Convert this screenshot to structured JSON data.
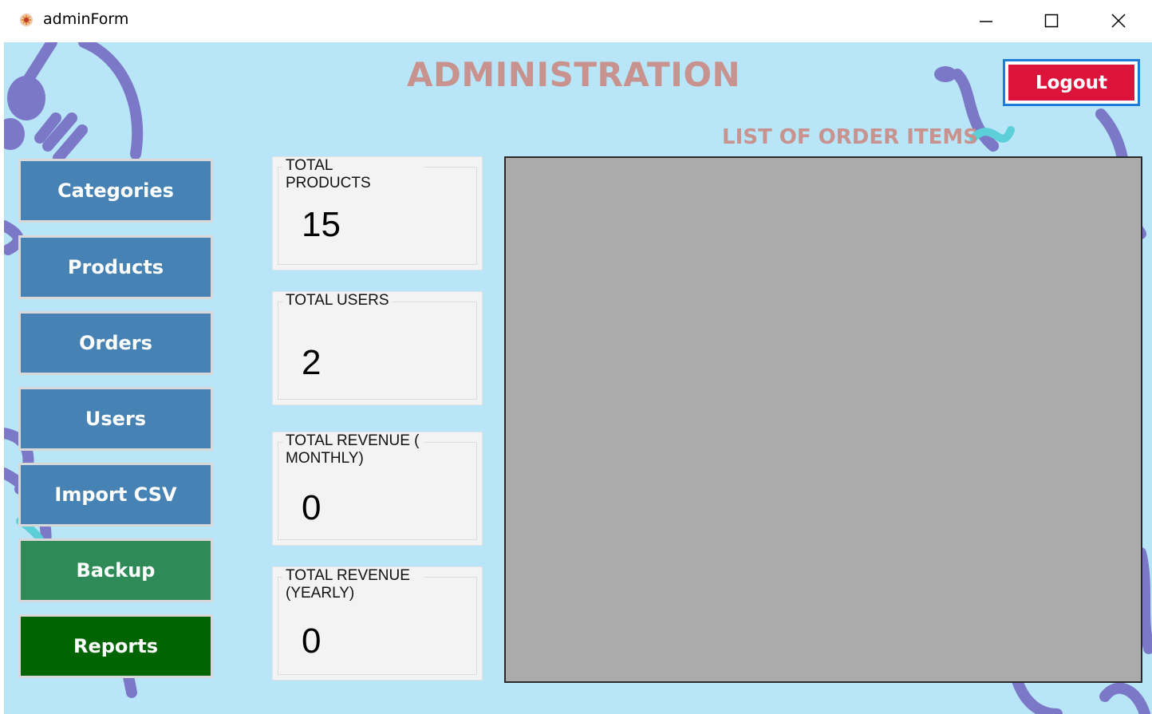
{
  "window": {
    "title": "adminForm",
    "icons": {
      "app": "app-icon",
      "minimize": "minimize-icon",
      "maximize": "maximize-icon",
      "close": "close-icon"
    }
  },
  "header": {
    "title": "ADMINISTRATION",
    "logout_label": "Logout",
    "orders_title": "LIST OF ORDER ITEMS"
  },
  "nav": [
    {
      "label": "Categories",
      "color": "#4682b4"
    },
    {
      "label": "Products",
      "color": "#4682b4"
    },
    {
      "label": "Orders",
      "color": "#4682b4"
    },
    {
      "label": "Users",
      "color": "#4682b4"
    },
    {
      "label": "Import CSV",
      "color": "#4682b4"
    },
    {
      "label": "Backup",
      "color": "#2e8b57"
    },
    {
      "label": "Reports",
      "color": "#006400"
    }
  ],
  "stats": [
    {
      "label": "TOTAL PRODUCTS",
      "value": "15"
    },
    {
      "label": "TOTAL USERS",
      "value": "2"
    },
    {
      "label": "TOTAL REVENUE ( MONTHLY)",
      "value": "0"
    },
    {
      "label": "TOTAL REVENUE (YEARLY)",
      "value": "0"
    }
  ],
  "colors": {
    "background": "#b9e5f8",
    "title": "#c8938e",
    "logout": "#dc143c",
    "grid": "#ababab",
    "deco": "#7b78c8",
    "deco_accent": "#5ccfd8"
  }
}
